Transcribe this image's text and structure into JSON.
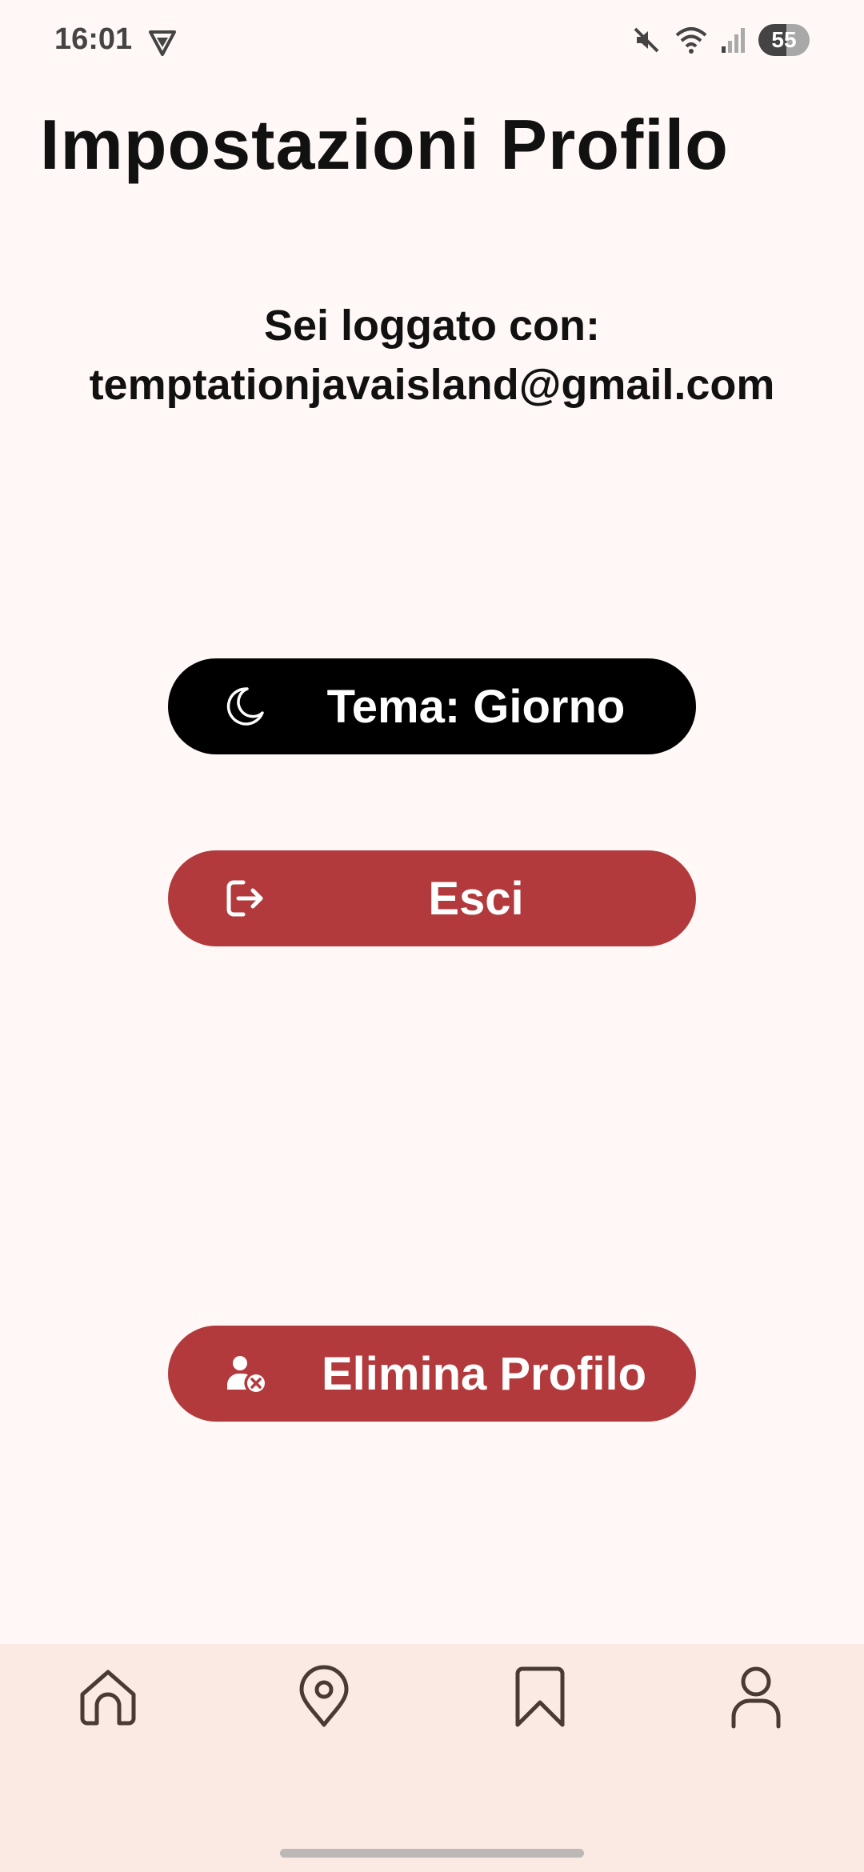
{
  "status_bar": {
    "time": "16:01",
    "battery": "55"
  },
  "page": {
    "title": "Impostazioni Profilo",
    "login_label": "Sei loggato con:",
    "email": "temptationjavaisland@gmail.com"
  },
  "buttons": {
    "theme": {
      "label": "Tema: Giorno",
      "icon": "moon-icon"
    },
    "logout": {
      "label": "Esci",
      "icon": "logout-icon"
    },
    "delete": {
      "label": "Elimina Profilo",
      "icon": "user-remove-icon"
    }
  },
  "bottom_nav": {
    "items": [
      "home-icon",
      "location-pin-icon",
      "bookmark-icon",
      "profile-icon"
    ],
    "active": "profile-icon"
  },
  "colors": {
    "background": "#fff8f6",
    "primary_red": "#b23a3d",
    "theme_button": "#000000",
    "nav_background": "#fbeae4",
    "nav_icon": "#4a3a36"
  }
}
